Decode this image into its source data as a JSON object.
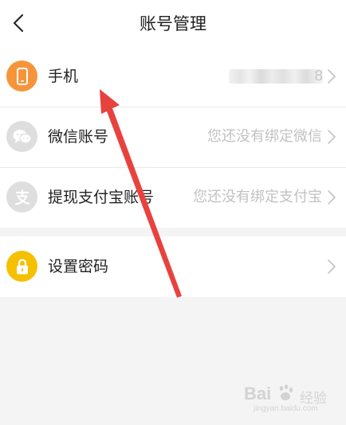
{
  "header": {
    "title": "账号管理"
  },
  "account_items": [
    {
      "label": "手机",
      "value_visible_digit": "8",
      "icon": "phone-icon",
      "icon_color": "#f7943a"
    },
    {
      "label": "微信账号",
      "value": "您还没有绑定微信",
      "icon": "wechat-icon",
      "icon_color": "#dedede"
    },
    {
      "label": "提现支付宝账号",
      "value": "您还没有绑定支付宝",
      "icon": "alipay-icon",
      "icon_color": "#dedede"
    }
  ],
  "security_items": [
    {
      "label": "设置密码",
      "icon": "lock-icon",
      "icon_color": "#f5c000"
    }
  ],
  "annotation": {
    "arrow_color": "#e8423f"
  },
  "watermark": {
    "brand": "Bai",
    "sub": "经验",
    "url": "jingyan.baidu.com"
  }
}
